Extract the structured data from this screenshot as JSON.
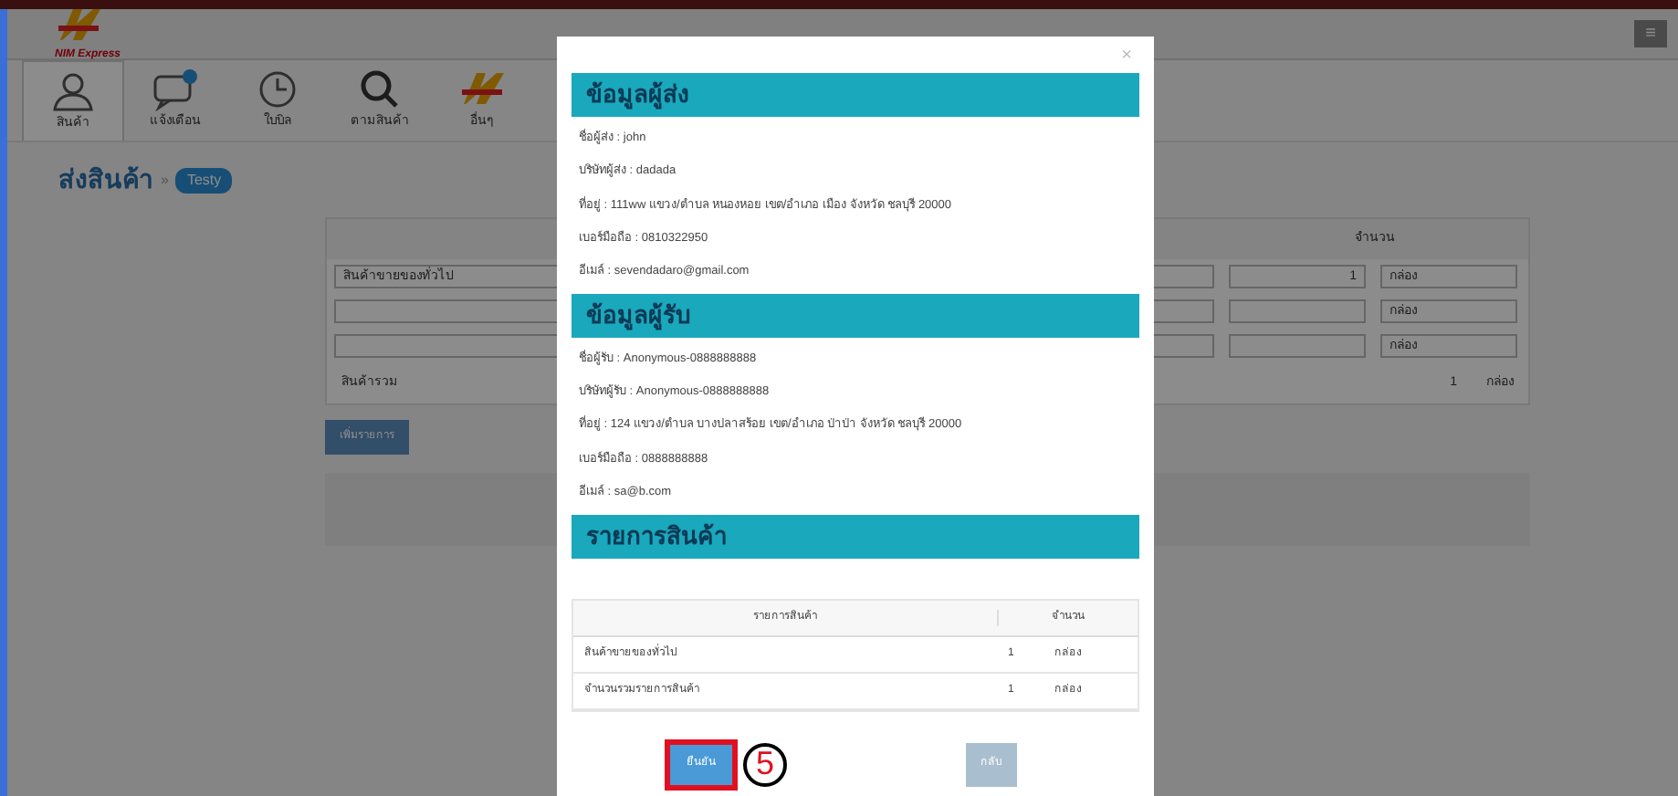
{
  "header": {
    "logo_text": "NIM Express",
    "menu_icon": "≡"
  },
  "nav_tabs": [
    {
      "label": "สินค้า",
      "kind": "user",
      "selected": true
    },
    {
      "label": "แจ้งเตือน",
      "kind": "chat",
      "selected": false
    },
    {
      "label": "ใบบิล",
      "kind": "clock",
      "selected": false
    },
    {
      "label": "ตามสินค้า",
      "kind": "search",
      "selected": false
    },
    {
      "label": "อื่นๆ",
      "kind": "logo",
      "selected": false
    }
  ],
  "breadcrumb": {
    "title": "ส่งสินค้า",
    "separator": "»",
    "badge": "Testy"
  },
  "order_table": {
    "column_2": "จำนวน",
    "rows": [
      {
        "item": "สินค้าขายของทั่วไป",
        "qty": "1",
        "unit": "กล่อง"
      },
      {
        "item": "",
        "qty": "",
        "unit": "กล่อง"
      },
      {
        "item": "",
        "qty": "",
        "unit": "กล่อง"
      }
    ],
    "total": {
      "label": "สินค้ารวม",
      "qty": "1",
      "unit": "กล่อง"
    }
  },
  "add_button": "เพิ่มรายการ",
  "modal": {
    "close": "×",
    "sections": [
      {
        "kind": "info",
        "title": "ข้อมูลผู้ส่ง",
        "lines": [
          "ชื่อผู้ส่ง : john",
          "บริษัทผู้ส่ง : dadada",
          "ที่อยู่ : 111ww แขวง/ตำบล หนองหอย เขต/อำเภอ เมือง จังหวัด ชลบุรี 20000",
          "เบอร์มือถือ : 0810322950",
          "อีเมล์ : sevendadaro@gmail.com"
        ]
      },
      {
        "kind": "info",
        "title": "ข้อมูลผู้รับ",
        "lines": [
          "ชื่อผู้รับ : Anonymous-0888888888",
          "บริษัทผู้รับ : Anonymous-0888888888",
          "ที่อยู่ : 124 แขวง/ตำบล บางปลาสร้อย เขต/อำเภอ ป่าป่า จังหวัด ชลบุรี 20000",
          "เบอร์มือถือ : 0888888888",
          "อีเมล์ : sa@b.com"
        ]
      },
      {
        "kind": "items",
        "title": "รายการสินค้า",
        "columns": [
          "รายการสินค้า",
          "จำนวน"
        ],
        "rows": [
          {
            "item": "สินค้าขายของทั่วไป",
            "qty": "1",
            "unit": "กล่อง"
          },
          {
            "item": "จำนวนรวมรายการสินค้า",
            "qty": "1",
            "unit": "กล่อง"
          }
        ]
      }
    ],
    "confirm_button": "ยืนยัน",
    "back_button": "กลับ",
    "step_marker": "5"
  }
}
